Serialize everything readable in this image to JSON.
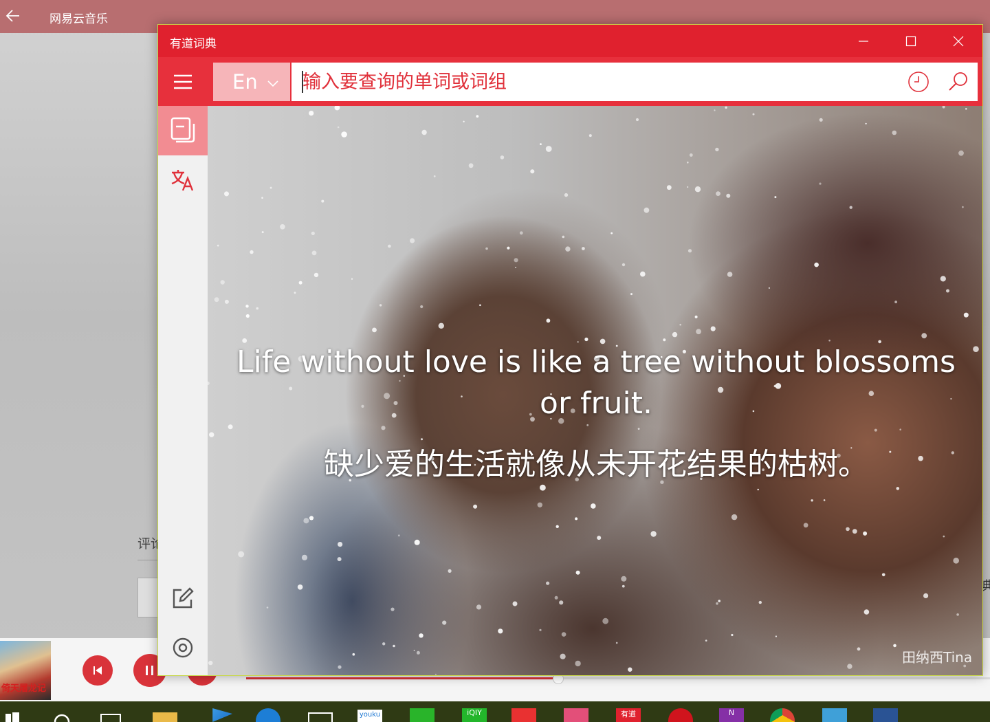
{
  "background_app": {
    "title": "网易云音乐",
    "comment_label": "评论",
    "right_edge_text": "典",
    "cover_text": "倚天屠龙记",
    "progress_fraction": 0.42
  },
  "youdao": {
    "title": "有道词典",
    "window_controls": {
      "minimize": "minimize",
      "maximize": "maximize",
      "close": "close"
    },
    "lang_selector": "En",
    "search_placeholder": "输入要查询的单词或词组",
    "sidebar": [
      "dictionary",
      "translate",
      "notes",
      "settings"
    ],
    "daily_sentence": {
      "english": "Life without love is like a tree without blossoms or fruit.",
      "chinese": "缺少爱的生活就像从未开花结果的枯树。",
      "credit": "田纳西Tina"
    },
    "accent_color": "#e0212e"
  },
  "taskbar": {
    "items": [
      "start",
      "search",
      "task-view",
      "file-explorer",
      "media-player",
      "edge",
      "store",
      "youku",
      "wechat",
      "iqiyi",
      "app",
      "app",
      "youdao-dict",
      "netease-music",
      "onenote",
      "chrome",
      "app",
      "app"
    ],
    "youku_label": "youku",
    "iqiyi_label": "iQIY",
    "youdao_label": "有道",
    "onenote_label": "N"
  }
}
